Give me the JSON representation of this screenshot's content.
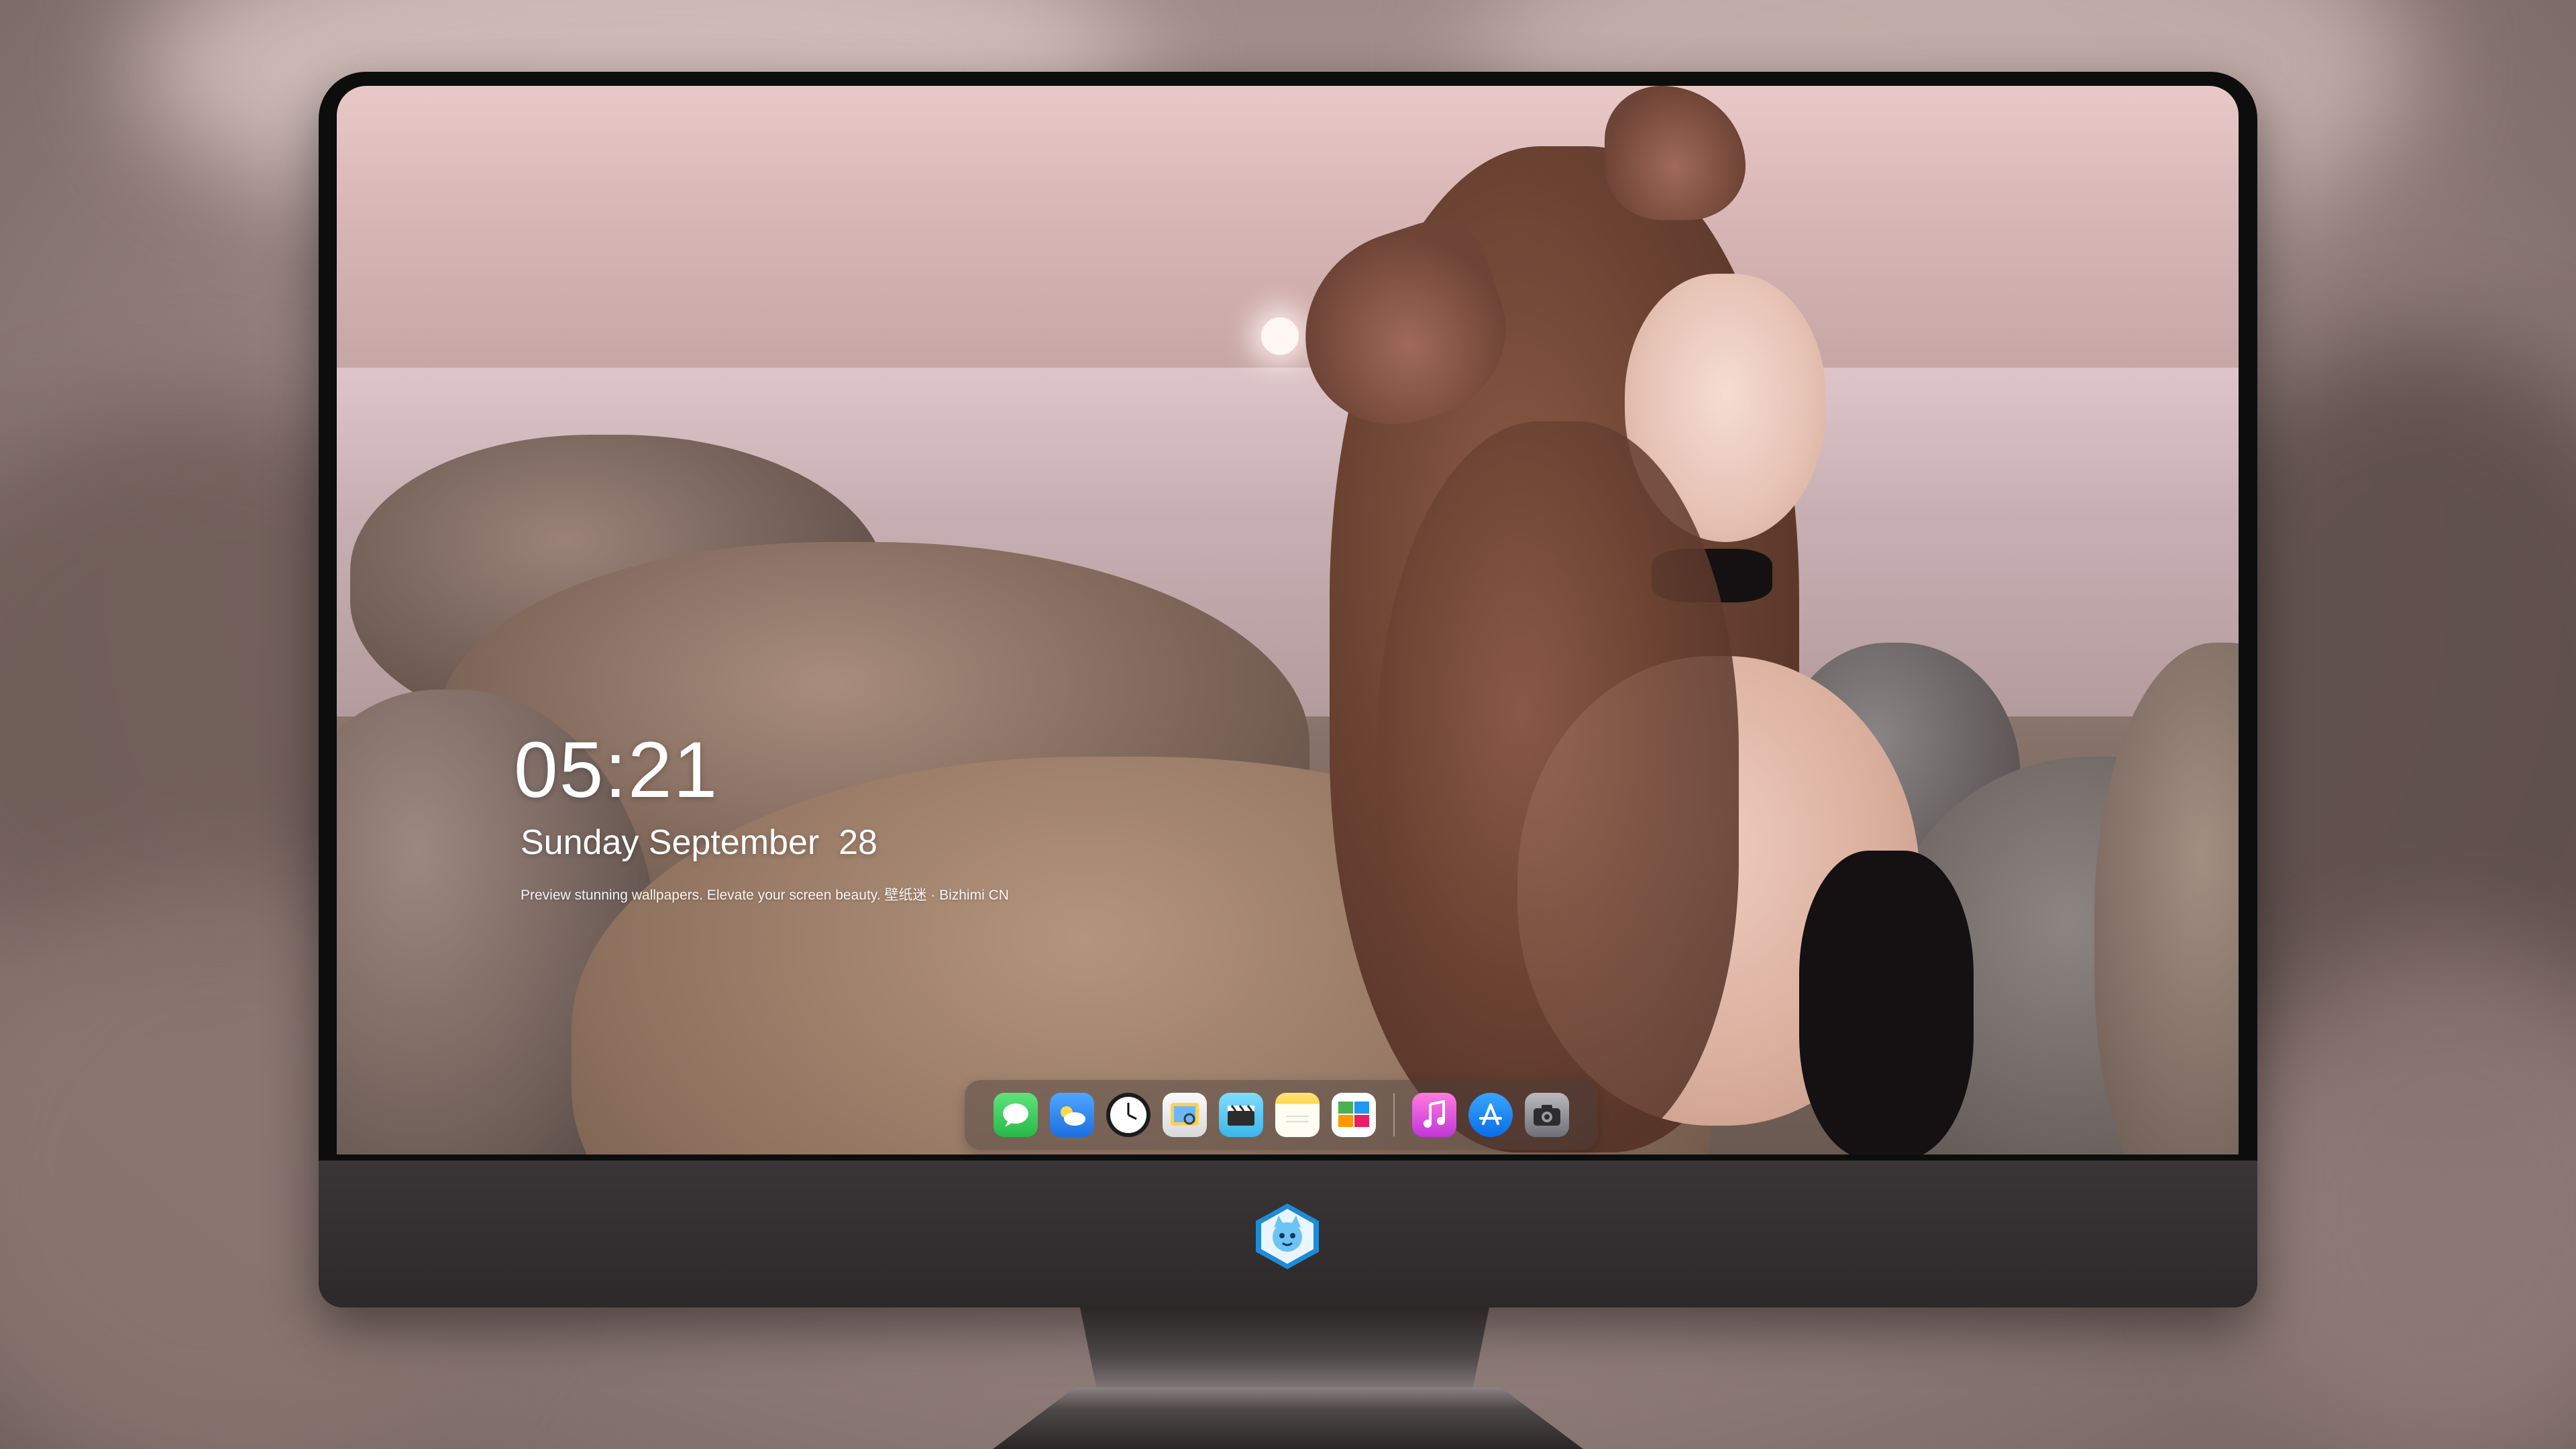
{
  "lockscreen": {
    "time": "05:21",
    "date": "Sunday September  28",
    "tagline": "Preview stunning wallpapers. Elevate your screen beauty. 壁纸迷 · Bizhimi CN"
  },
  "dock": {
    "apps": [
      {
        "name": "Messages",
        "icon": "messages-icon",
        "color": "#34c759"
      },
      {
        "name": "Weather",
        "icon": "weather-icon",
        "color": "#2f8df5"
      },
      {
        "name": "Clock",
        "icon": "clock-icon",
        "color": "#1c1c1e"
      },
      {
        "name": "Preview",
        "icon": "preview-icon",
        "color": "#f5f5f5"
      },
      {
        "name": "Clips",
        "icon": "clapperboard-icon",
        "color": "#5ac8fa"
      },
      {
        "name": "Notes",
        "icon": "notes-icon",
        "color": "#ffd84d"
      },
      {
        "name": "Photo Gallery",
        "icon": "gallery-icon",
        "color": "#ffffff"
      },
      {
        "name": "Music",
        "icon": "music-icon",
        "color": "#e84fd6"
      },
      {
        "name": "App Store",
        "icon": "app-store-icon",
        "color": "#1a8cff"
      },
      {
        "name": "Camera",
        "icon": "camera-icon",
        "color": "#8e8e93"
      }
    ]
  },
  "monitor": {
    "logo": "mascot-logo"
  }
}
